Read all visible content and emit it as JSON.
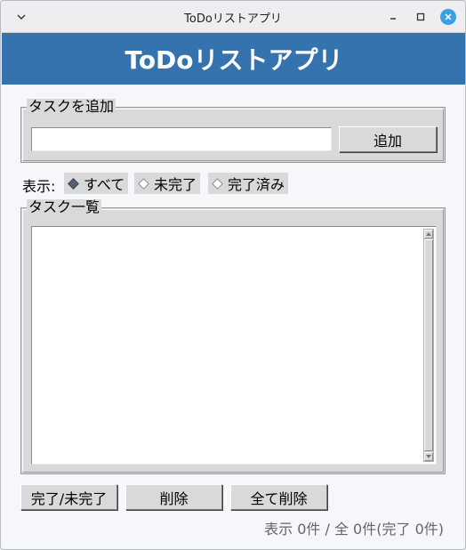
{
  "window": {
    "title": "ToDoリストアプリ"
  },
  "header": {
    "title": "ToDoリストアプリ",
    "background": "#3573ae"
  },
  "add_group": {
    "label": "タスクを追加",
    "input_value": "",
    "input_placeholder": "",
    "add_button": "追加"
  },
  "filter": {
    "label": "表示:",
    "options": [
      {
        "label": "すべて",
        "selected": true
      },
      {
        "label": "未完了",
        "selected": false
      },
      {
        "label": "完了済み",
        "selected": false
      }
    ]
  },
  "list_group": {
    "label": "タスク一覧",
    "items": []
  },
  "actions": {
    "toggle": "完了/未完了",
    "delete": "削除",
    "delete_all": "全て削除"
  },
  "status": {
    "text": "表示 0件 / 全 0件(完了 0件)"
  },
  "icons": {
    "menu": "chevron-down-icon",
    "minimize": "minimize-icon",
    "maximize": "maximize-icon",
    "close": "close-icon"
  }
}
